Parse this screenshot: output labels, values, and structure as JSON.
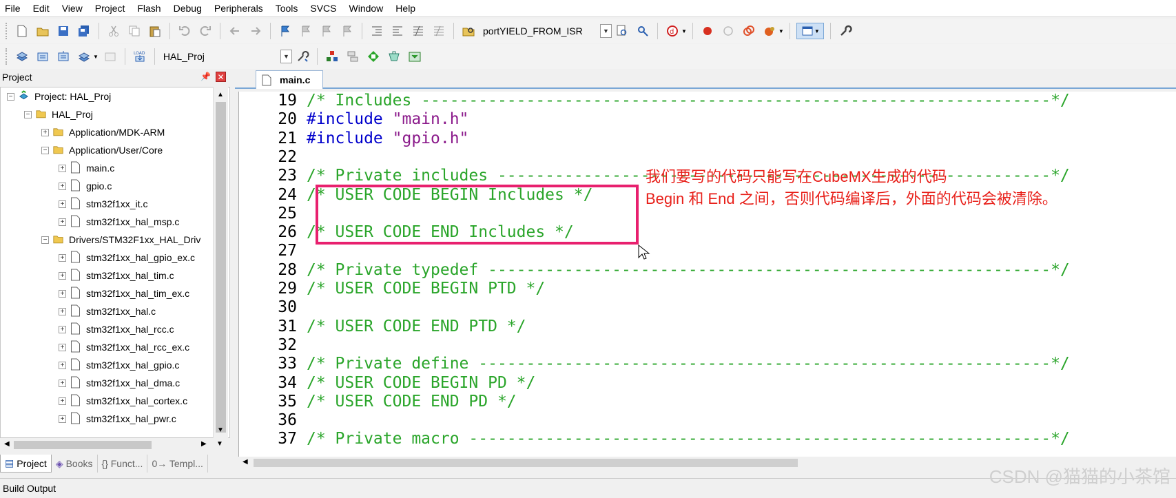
{
  "menu": [
    "File",
    "Edit",
    "View",
    "Project",
    "Flash",
    "Debug",
    "Peripherals",
    "Tools",
    "SVCS",
    "Window",
    "Help"
  ],
  "toolbar1": {
    "function_combo": "portYIELD_FROM_ISR"
  },
  "toolbar2": {
    "target_combo": "HAL_Proj",
    "load_label": "LOAD"
  },
  "project_panel": {
    "title": "Project",
    "tree": [
      {
        "label": "Project: HAL_Proj",
        "level": 0,
        "expander": "⊟",
        "icon": "project-icon"
      },
      {
        "label": "HAL_Proj",
        "level": 1,
        "expander": "⊟",
        "icon": "folder-icon"
      },
      {
        "label": "Application/MDK-ARM",
        "level": 2,
        "expander": "⊞",
        "icon": "folder-icon"
      },
      {
        "label": "Application/User/Core",
        "level": 2,
        "expander": "⊟",
        "icon": "folder-icon"
      },
      {
        "label": "main.c",
        "level": 3,
        "expander": "⊞",
        "icon": "file-icon"
      },
      {
        "label": "gpio.c",
        "level": 3,
        "expander": "⊞",
        "icon": "file-icon"
      },
      {
        "label": "stm32f1xx_it.c",
        "level": 3,
        "expander": "⊞",
        "icon": "file-icon"
      },
      {
        "label": "stm32f1xx_hal_msp.c",
        "level": 3,
        "expander": "⊞",
        "icon": "file-icon"
      },
      {
        "label": "Drivers/STM32F1xx_HAL_Driv",
        "level": 2,
        "expander": "⊟",
        "icon": "folder-icon"
      },
      {
        "label": "stm32f1xx_hal_gpio_ex.c",
        "level": 3,
        "expander": "⊞",
        "icon": "file-icon"
      },
      {
        "label": "stm32f1xx_hal_tim.c",
        "level": 3,
        "expander": "⊞",
        "icon": "file-icon"
      },
      {
        "label": "stm32f1xx_hal_tim_ex.c",
        "level": 3,
        "expander": "⊞",
        "icon": "file-icon"
      },
      {
        "label": "stm32f1xx_hal.c",
        "level": 3,
        "expander": "⊞",
        "icon": "file-icon"
      },
      {
        "label": "stm32f1xx_hal_rcc.c",
        "level": 3,
        "expander": "⊞",
        "icon": "file-icon"
      },
      {
        "label": "stm32f1xx_hal_rcc_ex.c",
        "level": 3,
        "expander": "⊞",
        "icon": "file-icon"
      },
      {
        "label": "stm32f1xx_hal_gpio.c",
        "level": 3,
        "expander": "⊞",
        "icon": "file-icon"
      },
      {
        "label": "stm32f1xx_hal_dma.c",
        "level": 3,
        "expander": "⊞",
        "icon": "file-icon"
      },
      {
        "label": "stm32f1xx_hal_cortex.c",
        "level": 3,
        "expander": "⊞",
        "icon": "file-icon"
      },
      {
        "label": "stm32f1xx_hal_pwr.c",
        "level": 3,
        "expander": "⊞",
        "icon": "file-icon"
      }
    ],
    "tabs": [
      "Project",
      "Books",
      "{} Funct...",
      "0→ Templ..."
    ]
  },
  "editor": {
    "tab": "main.c",
    "lines": [
      {
        "n": "19",
        "t": "/* Includes ------------------------------------------------------------------*/",
        "c": "comment"
      },
      {
        "n": "20",
        "t": "#include \"main.h\"",
        "c": "include"
      },
      {
        "n": "21",
        "t": "#include \"gpio.h\"",
        "c": "include"
      },
      {
        "n": "22",
        "t": "",
        "c": "comment"
      },
      {
        "n": "23",
        "t": "/* Private includes ----------------------------------------------------------*/",
        "c": "comment"
      },
      {
        "n": "24",
        "t": "/* USER CODE BEGIN Includes */",
        "c": "comment"
      },
      {
        "n": "25",
        "t": "",
        "c": "comment"
      },
      {
        "n": "26",
        "t": "/* USER CODE END Includes */",
        "c": "comment"
      },
      {
        "n": "27",
        "t": "",
        "c": "comment"
      },
      {
        "n": "28",
        "t": "/* Private typedef -----------------------------------------------------------*/",
        "c": "comment"
      },
      {
        "n": "29",
        "t": "/* USER CODE BEGIN PTD */",
        "c": "comment"
      },
      {
        "n": "30",
        "t": "",
        "c": "comment"
      },
      {
        "n": "31",
        "t": "/* USER CODE END PTD */",
        "c": "comment"
      },
      {
        "n": "32",
        "t": "",
        "c": "comment"
      },
      {
        "n": "33",
        "t": "/* Private define ------------------------------------------------------------*/",
        "c": "comment"
      },
      {
        "n": "34",
        "t": "/* USER CODE BEGIN PD */",
        "c": "comment"
      },
      {
        "n": "35",
        "t": "/* USER CODE END PD */",
        "c": "comment"
      },
      {
        "n": "36",
        "t": "",
        "c": "comment"
      },
      {
        "n": "37",
        "t": "/* Private macro -------------------------------------------------------------*/",
        "c": "comment"
      }
    ]
  },
  "annotation": {
    "line1": "我们要写的代码只能写在CubeMX生成的代码",
    "line2": "Begin 和 End 之间，否则代码编译后，外面的代码会被清除。",
    "color": "#e8201a"
  },
  "build_output": {
    "title": "Build Output"
  },
  "watermark": "CSDN @猫猫的小茶馆"
}
